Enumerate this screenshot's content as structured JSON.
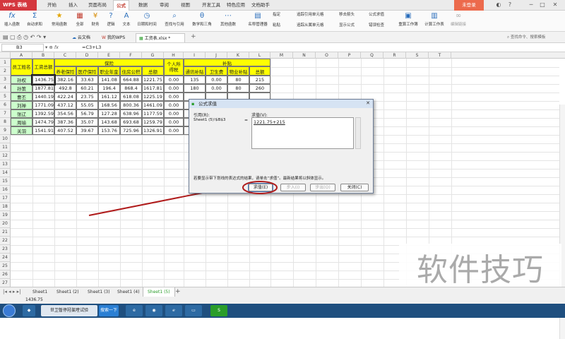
{
  "app": {
    "title": "WPS 表格",
    "login": "未登录"
  },
  "menu_tabs": [
    "开始",
    "插入",
    "页面布局",
    "公式",
    "数据",
    "审阅",
    "视图",
    "开发工具",
    "特色应用",
    "文档助手"
  ],
  "active_menu_tab": "公式",
  "ribbon": {
    "insert_function": "插入函数",
    "autosum": "自动求和",
    "common_funcs": "常用函数",
    "all_funcs": "全部",
    "finance": "财务",
    "logic": "逻辑",
    "text": "文本",
    "datetime": "日期和时间",
    "lookup": "查找与引用",
    "math": "数学和三角",
    "other": "其他函数",
    "name_manager": "名称管理器",
    "paste": "粘贴",
    "specify": "指定",
    "trace_precedents": "追踪引用单元格",
    "trace_dependents": "追踪从属单元格",
    "remove_arrows": "移去箭头",
    "show_formulas": "显示公式",
    "evaluate": "公式求值",
    "error_check": "错误检查",
    "recalc_workbook": "重算工作簿",
    "calc_sheet": "计算工作表",
    "edit_links": "编辑链接"
  },
  "doc_tabs": [
    "云文档",
    "我的WPS",
    "工资表.xlsx *"
  ],
  "search_box": "查找命令、搜索模板",
  "name_box": "B3",
  "formula": "=C3+L3",
  "column_headers": [
    "A",
    "B",
    "C",
    "D",
    "E",
    "F",
    "G",
    "H",
    "I",
    "J",
    "K",
    "L",
    "M",
    "N",
    "O",
    "P",
    "Q",
    "R",
    "S",
    "T"
  ],
  "table": {
    "headers": {
      "name": "员工姓名",
      "total": "工资总额",
      "insurance": "保险",
      "pension": "养老保险",
      "medical": "医疗保险",
      "annuity": "职业年金",
      "housing": "住房公积",
      "ins_total": "总额",
      "tax": "个人所得税",
      "subsidy": "补贴",
      "transport": "通讯补贴",
      "health": "卫生费",
      "property": "物业补贴",
      "sub_total": "总额"
    },
    "rows": [
      [
        "孙权",
        "1436.75",
        "382.16",
        "33.63",
        "141.08",
        "664.88",
        "1221.75",
        "0.00",
        "135",
        "0.00",
        "80",
        "215"
      ],
      [
        "孙策",
        "1877.81",
        "492.8",
        "60.21",
        "196.4",
        "868.4",
        "1617.81",
        "0.00",
        "180",
        "0.00",
        "80",
        "260"
      ],
      [
        "曹丕",
        "1440.19",
        "422.24",
        "23.75",
        "161.12",
        "618.08",
        "1225.19",
        "0.00",
        "",
        "",
        "",
        ""
      ],
      [
        "刘禅",
        "1771.09",
        "437.12",
        "55.05",
        "168.56",
        "800.36",
        "1461.09",
        "0.00",
        "",
        "",
        "",
        ""
      ],
      [
        "张辽",
        "1392.59",
        "354.56",
        "56.79",
        "127.28",
        "638.96",
        "1177.59",
        "0.00",
        "",
        "",
        "",
        ""
      ],
      [
        "周瑜",
        "1474.79",
        "387.36",
        "35.07",
        "143.68",
        "693.68",
        "1259.79",
        "0.00",
        "",
        "",
        "",
        ""
      ],
      [
        "关羽",
        "1541.91",
        "407.52",
        "39.67",
        "153.76",
        "725.96",
        "1326.91",
        "0.00",
        "",
        "",
        "",
        ""
      ]
    ]
  },
  "dialog": {
    "title": "公式求值",
    "ref_label": "引用(R):",
    "ref_value": "Sheet1 (5)!$B$3",
    "eq": "=",
    "value_label": "求值(V):",
    "value": "1221.75+215",
    "hint": "若要显示带下划线的表达式的结果，请单击“求值”。最新结果将以斜体显示。",
    "btn_evaluate": "求值(E)",
    "btn_step_in": "步入(I)",
    "btn_step_out": "步出(O)",
    "btn_close": "关闭(C)"
  },
  "sheet_tabs": [
    "Sheet1",
    "Sheet1 (2)",
    "Sheet1 (3)",
    "Sheet1 (4)",
    "Sheet1 (5)"
  ],
  "active_sheet": "Sheet1 (5)",
  "status_value": "1436.75",
  "taskbar": {
    "task1": "世卫暂停羟氯喹试验",
    "search": "搜索一下"
  },
  "watermark": "软件技巧"
}
